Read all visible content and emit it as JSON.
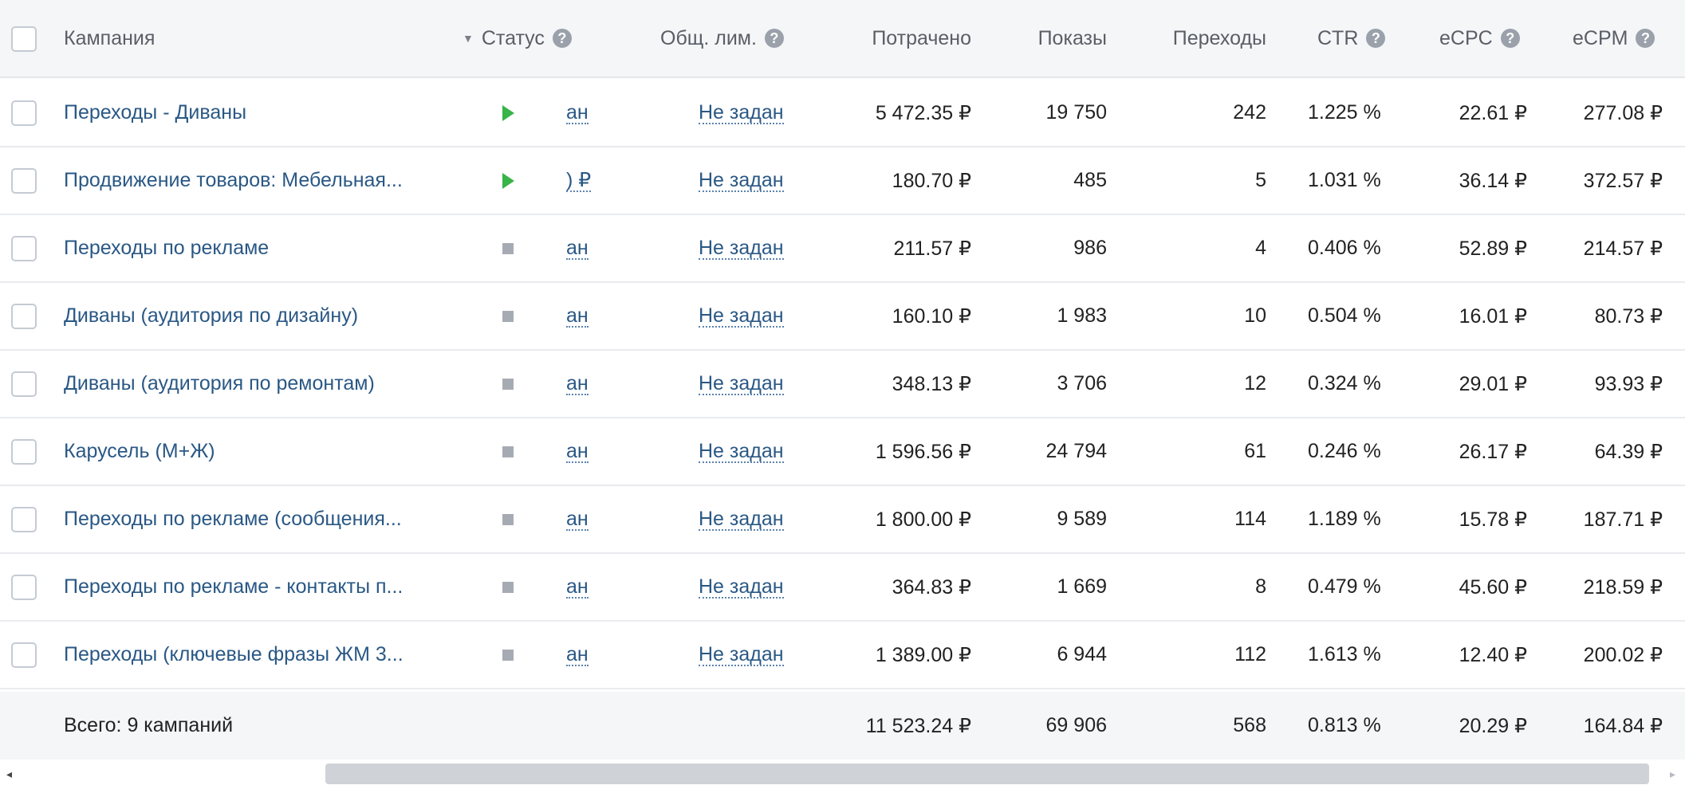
{
  "header": {
    "campaign": "Кампания",
    "status": "Статус",
    "limit": "Общ. лим.",
    "spent": "Потрачено",
    "impressions": "Показы",
    "clicks": "Переходы",
    "ctr": "CTR",
    "ecpc": "eCPC",
    "ecpm": "eCPM"
  },
  "icons": {
    "help": "question-circle-icon",
    "sort": "caret-down-icon",
    "running": "play-icon",
    "stopped": "stop-icon"
  },
  "colors": {
    "link": "#2a5885",
    "running": "#38b449",
    "stopped": "#a6abb3",
    "header_bg": "#f5f6f8"
  },
  "rows": [
    {
      "name": "Переходы - Диваны",
      "status": "running",
      "budget": "ан",
      "limit": "Не задан",
      "spent": "5 472.35 ₽",
      "impressions": "19 750",
      "clicks": "242",
      "ctr": "1.225 %",
      "ecpc": "22.61 ₽",
      "ecpm": "277.08 ₽"
    },
    {
      "name": "Продвижение товаров: Мебельная...",
      "status": "running",
      "budget": ") ₽",
      "limit": "Не задан",
      "spent": "180.70 ₽",
      "impressions": "485",
      "clicks": "5",
      "ctr": "1.031 %",
      "ecpc": "36.14 ₽",
      "ecpm": "372.57 ₽"
    },
    {
      "name": "Переходы по рекламе",
      "status": "stopped",
      "budget": "ан",
      "limit": "Не задан",
      "spent": "211.57 ₽",
      "impressions": "986",
      "clicks": "4",
      "ctr": "0.406 %",
      "ecpc": "52.89 ₽",
      "ecpm": "214.57 ₽"
    },
    {
      "name": "Диваны (аудитория по дизайну)",
      "status": "stopped",
      "budget": "ан",
      "limit": "Не задан",
      "spent": "160.10 ₽",
      "impressions": "1 983",
      "clicks": "10",
      "ctr": "0.504 %",
      "ecpc": "16.01 ₽",
      "ecpm": "80.73 ₽"
    },
    {
      "name": "Диваны (аудитория по ремонтам)",
      "status": "stopped",
      "budget": "ан",
      "limit": "Не задан",
      "spent": "348.13 ₽",
      "impressions": "3 706",
      "clicks": "12",
      "ctr": "0.324 %",
      "ecpc": "29.01 ₽",
      "ecpm": "93.93 ₽"
    },
    {
      "name": "Карусель (М+Ж)",
      "status": "stopped",
      "budget": "ан",
      "limit": "Не задан",
      "spent": "1 596.56 ₽",
      "impressions": "24 794",
      "clicks": "61",
      "ctr": "0.246 %",
      "ecpc": "26.17 ₽",
      "ecpm": "64.39 ₽"
    },
    {
      "name": "Переходы по рекламе (сообщения...",
      "status": "stopped",
      "budget": "ан",
      "limit": "Не задан",
      "spent": "1 800.00 ₽",
      "impressions": "9 589",
      "clicks": "114",
      "ctr": "1.189 %",
      "ecpc": "15.78 ₽",
      "ecpm": "187.71 ₽"
    },
    {
      "name": "Переходы по рекламе - контакты п...",
      "status": "stopped",
      "budget": "ан",
      "limit": "Не задан",
      "spent": "364.83 ₽",
      "impressions": "1 669",
      "clicks": "8",
      "ctr": "0.479 %",
      "ecpc": "45.60 ₽",
      "ecpm": "218.59 ₽"
    },
    {
      "name": "Переходы (ключевые фразы ЖМ 3...",
      "status": "stopped",
      "budget": "ан",
      "limit": "Не задан",
      "spent": "1 389.00 ₽",
      "impressions": "6 944",
      "clicks": "112",
      "ctr": "1.613 %",
      "ecpc": "12.40 ₽",
      "ecpm": "200.02 ₽"
    }
  ],
  "footer": {
    "label": "Всего: 9 кампаний",
    "spent": "11 523.24 ₽",
    "impressions": "69 906",
    "clicks": "568",
    "ctr": "0.813 %",
    "ecpc": "20.29 ₽",
    "ecpm": "164.84 ₽"
  },
  "scrollbar": {
    "left_arrow": "◂",
    "right_arrow": "▸"
  }
}
